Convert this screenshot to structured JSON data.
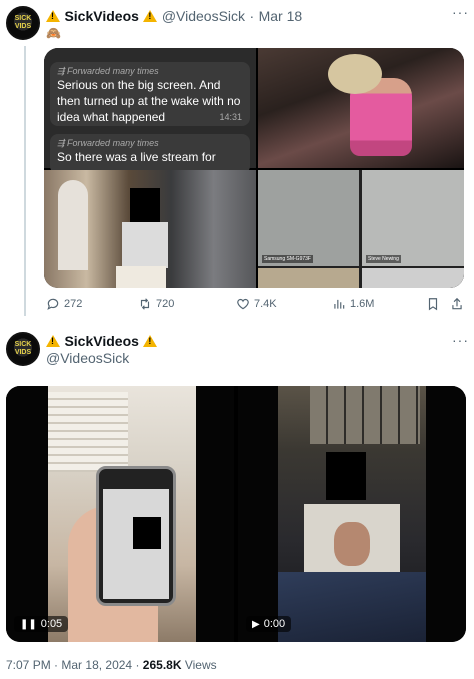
{
  "post1": {
    "name": "SickVideos",
    "handle": "@VideosSick",
    "date": "Mar 18",
    "emoji": "🙈",
    "chat": [
      {
        "forwarded": "Forwarded many times",
        "text": "Serious on the big screen. And then turned up at the wake with no idea what happened",
        "time": "14:31"
      },
      {
        "forwarded": "Forwarded many times",
        "text": "So there was a live stream for",
        "time": ""
      }
    ],
    "zoom_labels": [
      "Samsung SM-G973F",
      "Steve Newing"
    ],
    "metrics": {
      "replies": "272",
      "reposts": "720",
      "likes": "7.4K",
      "views": "1.6M"
    }
  },
  "post2": {
    "name": "SickVideos",
    "handle": "@VideosSick",
    "videos": [
      {
        "state": "pause",
        "time": "0:05"
      },
      {
        "state": "play",
        "time": "0:00"
      }
    ]
  },
  "footer": {
    "time": "7:07 PM",
    "date": "Mar 18, 2024",
    "views_count": "265.8K",
    "views_label": "Views"
  },
  "colors": {
    "accent": "#1d9bf0",
    "muted": "#536471",
    "warn": "#f4b400"
  }
}
